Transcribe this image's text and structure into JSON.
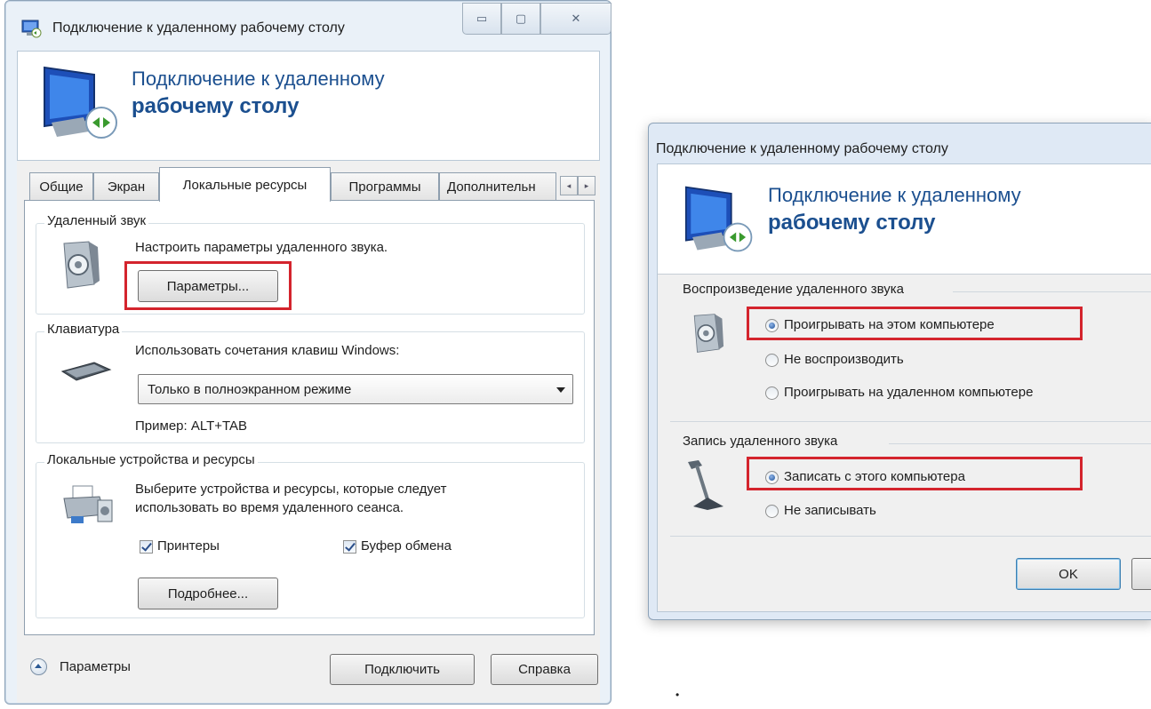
{
  "left_window": {
    "title": "Подключение к удаленному рабочему столу",
    "controls": {
      "minimize": "▭",
      "maximize": "▢",
      "close": "✕"
    },
    "banner": {
      "line1": "Подключение к удаленному",
      "line2": "рабочему столу"
    },
    "tabs": [
      "Общие",
      "Экран",
      "Локальные ресурсы",
      "Программы",
      "Дополнительн"
    ],
    "active_tab": "Локальные ресурсы",
    "tab_scroll": {
      "left": "◂",
      "right": "▸"
    },
    "remote_sound": {
      "title": "Удаленный звук",
      "description": "Настроить параметры удаленного звука.",
      "button": "Параметры..."
    },
    "keyboard": {
      "title": "Клавиатура",
      "description": "Использовать сочетания клавиш Windows:",
      "selected": "Только в полноэкранном режиме",
      "example": "Пример: ALT+TAB"
    },
    "local_devices": {
      "title": "Локальные устройства и ресурсы",
      "description_line1": "Выберите устройства и ресурсы, которые следует",
      "description_line2": "использовать во время удаленного сеанса.",
      "checkboxes": [
        {
          "label": "Принтеры",
          "checked": true
        },
        {
          "label": "Буфер обмена",
          "checked": true
        }
      ],
      "more_button": "Подробнее..."
    },
    "footer": {
      "options_label": "Параметры",
      "connect_button": "Подключить",
      "help_button": "Справка"
    }
  },
  "right_window": {
    "title": "Подключение к удаленному рабочему столу",
    "banner": {
      "line1": "Подключение к удаленному",
      "line2": "рабочему столу"
    },
    "playback": {
      "title": "Воспроизведение удаленного звука",
      "options": [
        {
          "label": "Проигрывать на этом компьютере",
          "selected": true
        },
        {
          "label": "Не воспроизводить",
          "selected": false
        },
        {
          "label": "Проигрывать на удаленном компьютере",
          "selected": false
        }
      ]
    },
    "recording": {
      "title": "Запись удаленного звука",
      "options": [
        {
          "label": "Записать с этого компьютера",
          "selected": true
        },
        {
          "label": "Не записывать",
          "selected": false
        }
      ]
    },
    "ok_button": "OK"
  },
  "stray_mark": "•",
  "colors": {
    "highlight": "#d4242d",
    "banner_text": "#1b4f8f"
  }
}
